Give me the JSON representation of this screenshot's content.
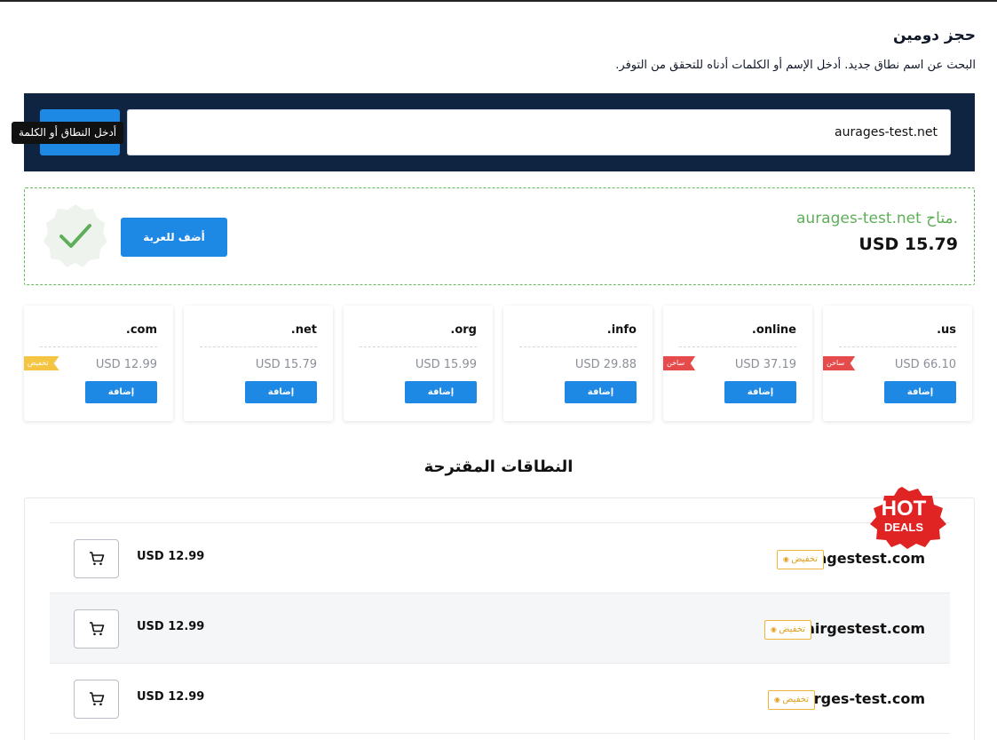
{
  "header": {
    "title": "حجز دومين",
    "subtitle": "البحث عن اسم نطاق جديد. أدخل الإسم أو الكلمات أدناه للتحقق من التوفر."
  },
  "search": {
    "value": "aurages-test.net",
    "tooltip": "أدخل النطاق أو الكلمة"
  },
  "availability": {
    "message": "aurages-test.net متاح.",
    "price": "USD 15.79",
    "add_to_cart": "أضف للعربة",
    "icon": "check-icon"
  },
  "tlds": [
    {
      "name": ".com",
      "price": "USD 12.99",
      "add": "إضافة",
      "badge": "تخفيض",
      "badge_type": "discount"
    },
    {
      "name": ".net",
      "price": "USD 15.79",
      "add": "إضافة",
      "badge": "",
      "badge_type": ""
    },
    {
      "name": ".org",
      "price": "USD 15.99",
      "add": "إضافة",
      "badge": "",
      "badge_type": ""
    },
    {
      "name": ".info",
      "price": "USD 29.88",
      "add": "إضافة",
      "badge": "",
      "badge_type": ""
    },
    {
      "name": ".online",
      "price": "USD 37.19",
      "add": "إضافة",
      "badge": "ساخن",
      "badge_type": "hot"
    },
    {
      "name": ".us",
      "price": "USD 66.10",
      "add": "إضافة",
      "badge": "ساخن",
      "badge_type": "hot"
    }
  ],
  "suggestions": {
    "title": "النطاقات المقترحة",
    "hot_deals": {
      "line1": "HOT",
      "line2": "DEALS"
    },
    "items": [
      {
        "domain": "auragestest.com",
        "badge": "تخفيض",
        "price": "USD 12.99"
      },
      {
        "domain": "airgestest.com",
        "badge": "تخفيض",
        "price": "USD 12.99"
      },
      {
        "domain": "airges-test.com",
        "badge": "تخفيض",
        "price": "USD 12.99"
      }
    ]
  },
  "colors": {
    "primary": "#1e88e5",
    "navy": "#0e2440",
    "success": "#5fae5a",
    "hot": "#e64b4b",
    "discount": "#f4c542",
    "badge_border": "#f0b43a"
  }
}
